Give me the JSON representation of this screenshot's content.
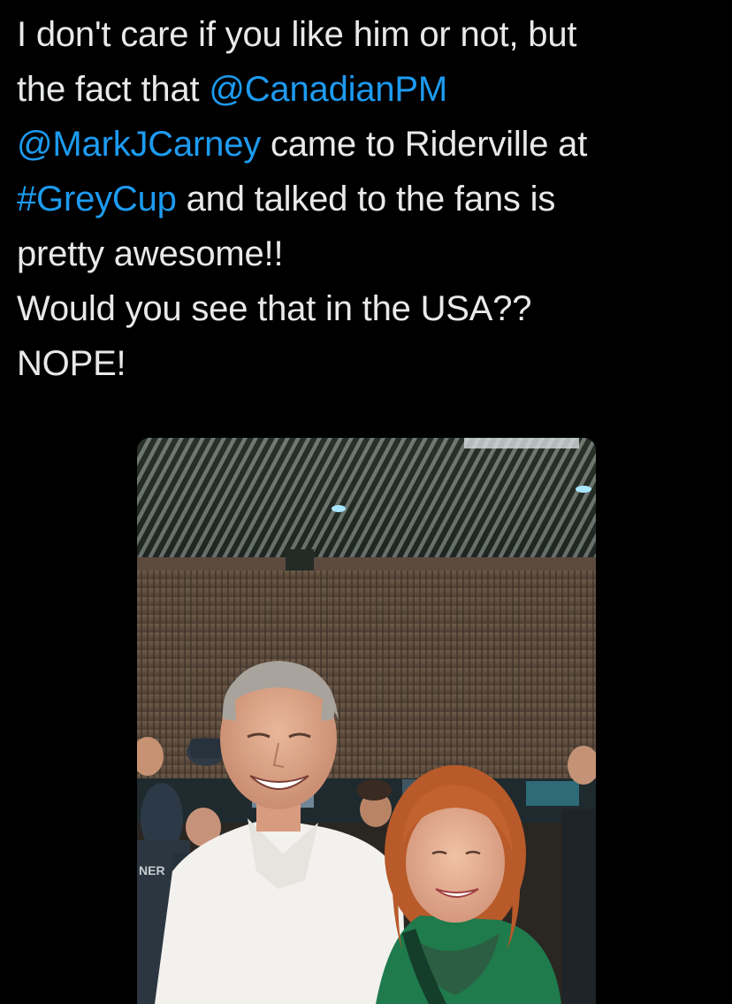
{
  "tweet": {
    "lines": [
      [
        {
          "kind": "text",
          "text": "I don't care if you like him or not, but"
        }
      ],
      [
        {
          "kind": "text",
          "text": "the fact that "
        },
        {
          "kind": "mention",
          "text": "@CanadianPM"
        }
      ],
      [
        {
          "kind": "mention",
          "text": "@MarkJCarney"
        },
        {
          "kind": "text",
          "text": " came to Riderville at"
        }
      ],
      [
        {
          "kind": "hashtag",
          "text": "#GreyCup"
        },
        {
          "kind": "text",
          "text": " and talked to the fans is"
        }
      ],
      [
        {
          "kind": "text",
          "text": "pretty awesome!!"
        }
      ],
      [
        {
          "kind": "text",
          "text": "Would you see that in the USA??"
        }
      ],
      [
        {
          "kind": "text",
          "text": "NOPE!"
        }
      ]
    ]
  },
  "photo": {
    "shirt_lettering": "NER"
  },
  "colors": {
    "background": "#000000",
    "text": "#e7e9ea",
    "link": "#1d9bf0"
  }
}
